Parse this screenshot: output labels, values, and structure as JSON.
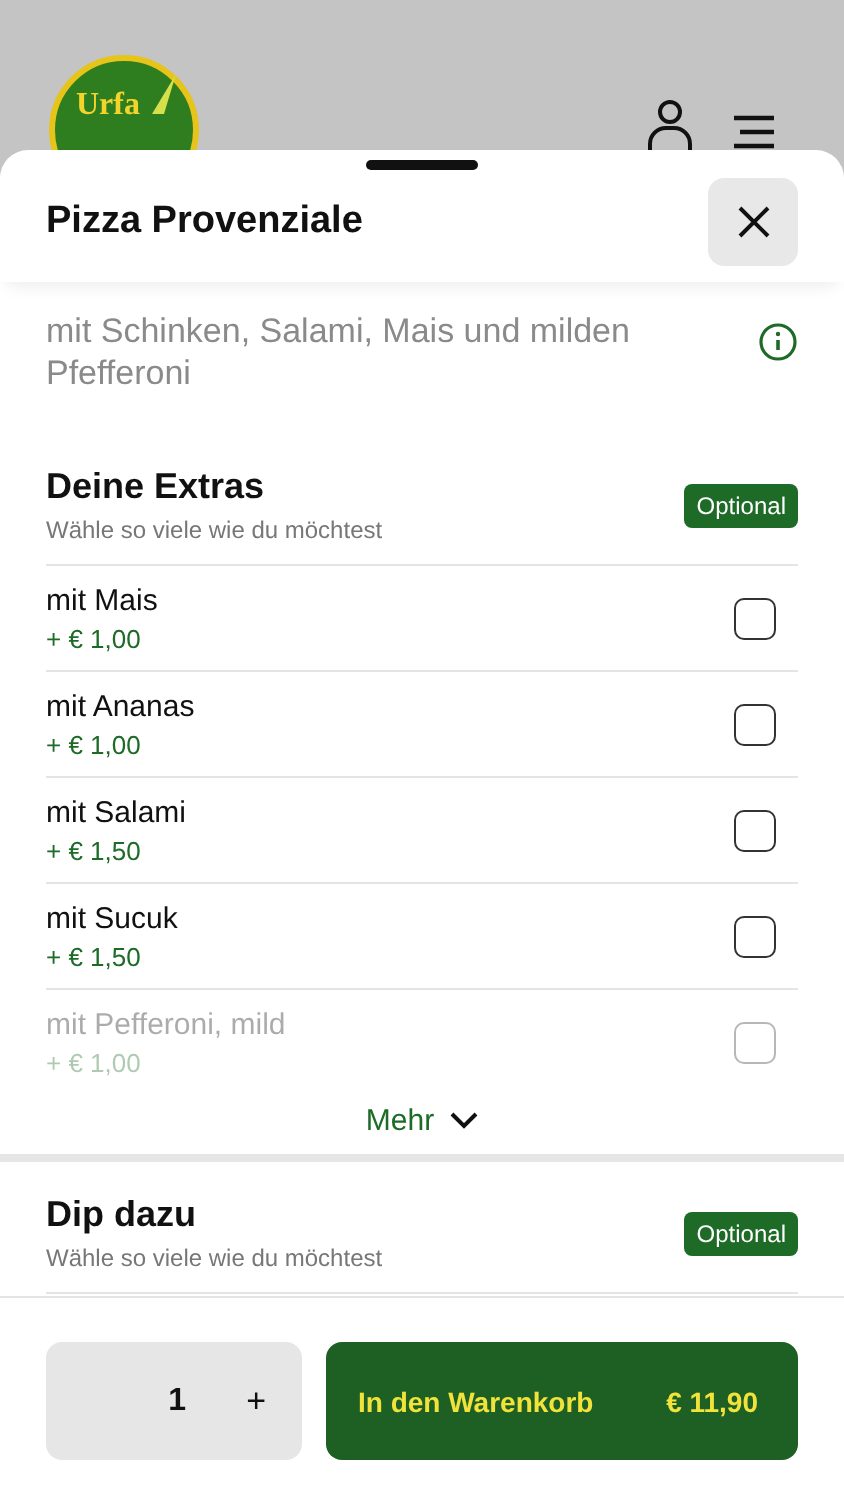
{
  "header": {
    "logo_text": "Urfa"
  },
  "sheet": {
    "title": "Pizza Provenziale",
    "description": "mit Schinken, Salami, Mais und milden Pfefferoni"
  },
  "sections": [
    {
      "title": "Deine Extras",
      "subtitle": "Wähle so viele wie du möchtest",
      "badge": "Optional",
      "more": "Mehr",
      "items": [
        {
          "name": "mit Mais",
          "price": "+ € 1,00",
          "checked": false,
          "faded": false
        },
        {
          "name": "mit Ananas",
          "price": "+ € 1,00",
          "checked": false,
          "faded": false
        },
        {
          "name": "mit Salami",
          "price": "+ € 1,50",
          "checked": false,
          "faded": false
        },
        {
          "name": "mit Sucuk",
          "price": "+ € 1,50",
          "checked": false,
          "faded": false
        },
        {
          "name": "mit Pefferoni, mild",
          "price": "+ € 1,00",
          "checked": false,
          "faded": true
        }
      ]
    },
    {
      "title": "Dip dazu",
      "subtitle": "Wähle so viele wie du möchtest",
      "badge": "Optional"
    }
  ],
  "footer": {
    "quantity": "1",
    "plus": "+",
    "cart_label": "In den Warenkorb",
    "total": "€ 11,90"
  }
}
